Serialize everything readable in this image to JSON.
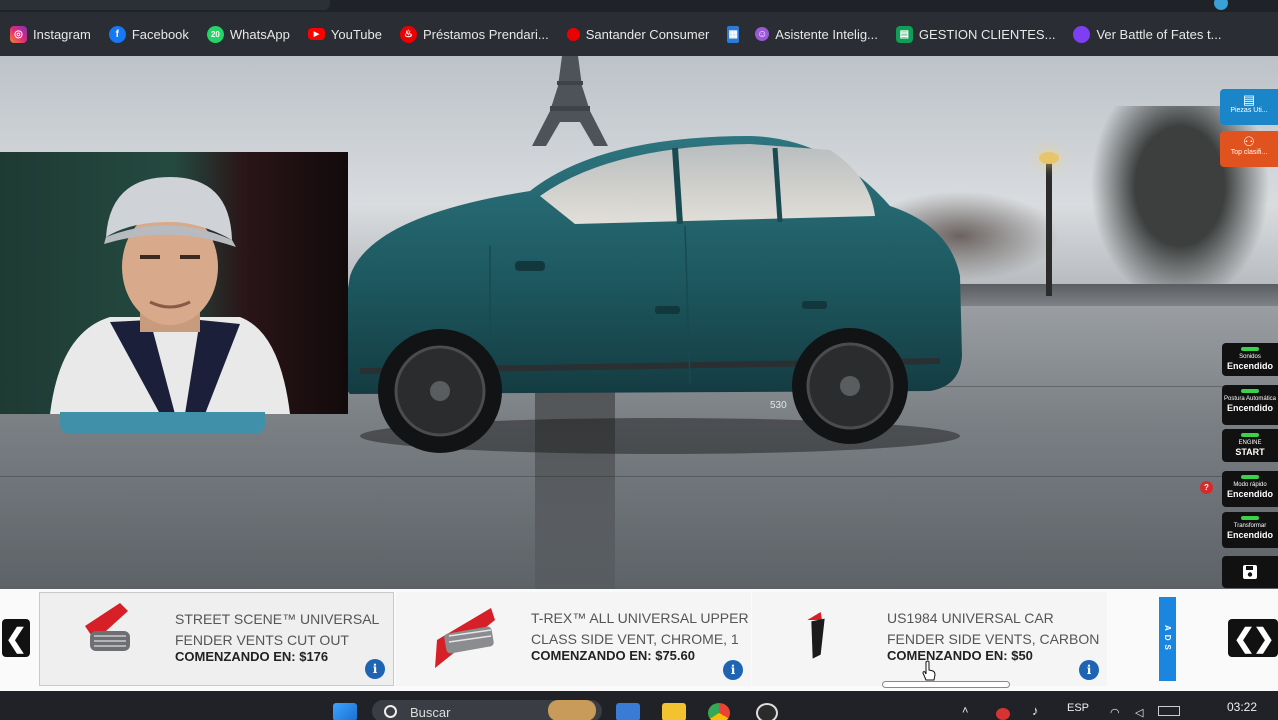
{
  "bookmarks": [
    {
      "label": "Instagram",
      "icon": "instagram-icon",
      "color": "#d6249f"
    },
    {
      "label": "Facebook",
      "icon": "facebook-icon",
      "color": "#1877f2"
    },
    {
      "label": "WhatsApp",
      "icon": "whatsapp-icon",
      "color": "#25d366",
      "badge": "20"
    },
    {
      "label": "YouTube",
      "icon": "youtube-icon",
      "color": "#ff0000"
    },
    {
      "label": "Préstamos Prendari...",
      "icon": "santander-flame-icon",
      "color": "#ec0000"
    },
    {
      "label": "Santander Consumer",
      "icon": "santander-car-icon",
      "color": "#ec0000"
    },
    {
      "label": "",
      "icon": "grid-app-icon",
      "color": "#2b7bd9"
    },
    {
      "label": "Asistente Intelig...",
      "icon": "assistant-icon",
      "color": "#9a59d6"
    },
    {
      "label": "GESTION CLIENTES...",
      "icon": "sheets-icon",
      "color": "#0f9d58"
    },
    {
      "label": "Ver Battle of Fates t...",
      "icon": "twitch-icon",
      "color": "#7e3ff2"
    }
  ],
  "right_panel": {
    "piezas": "Piezas Uti...",
    "top": "Top clasifi...",
    "sonidos_small": "Sonidos",
    "sonidos_big": "Encendido",
    "postura_small": "Postura Automática",
    "postura_big": "Encendido",
    "engine_small": "ENGINE",
    "engine_big": "START",
    "modo_small": "Modo rápido",
    "modo_big": "Encendido",
    "transformar_small": "Transformar",
    "transformar_big": "Encendido",
    "question_badge": "?"
  },
  "ads": [
    {
      "title": "STREET SCENE™ UNIVERSAL FENDER VENTS CUT OUT",
      "price": "COMENZANDO EN: $176",
      "info": "i"
    },
    {
      "title": "T-REX™ ALL UNIVERSAL UPPER CLASS SIDE VENT, CHROME, 1",
      "price": "COMENZANDO EN: $75.60",
      "info": "i"
    },
    {
      "title": "US1984 UNIVERSAL CAR FENDER SIDE VENTS, CARBON",
      "price": "COMENZANDO EN: $50",
      "info": "i"
    }
  ],
  "ads_tag": "ADS",
  "nav": {
    "left": "❮",
    "right": "❮❯"
  },
  "taskbar": {
    "search_placeholder": "Buscar",
    "lang": "ESP",
    "time": "03:22"
  },
  "car": {
    "color": "#1f5b63",
    "badge": "530"
  }
}
